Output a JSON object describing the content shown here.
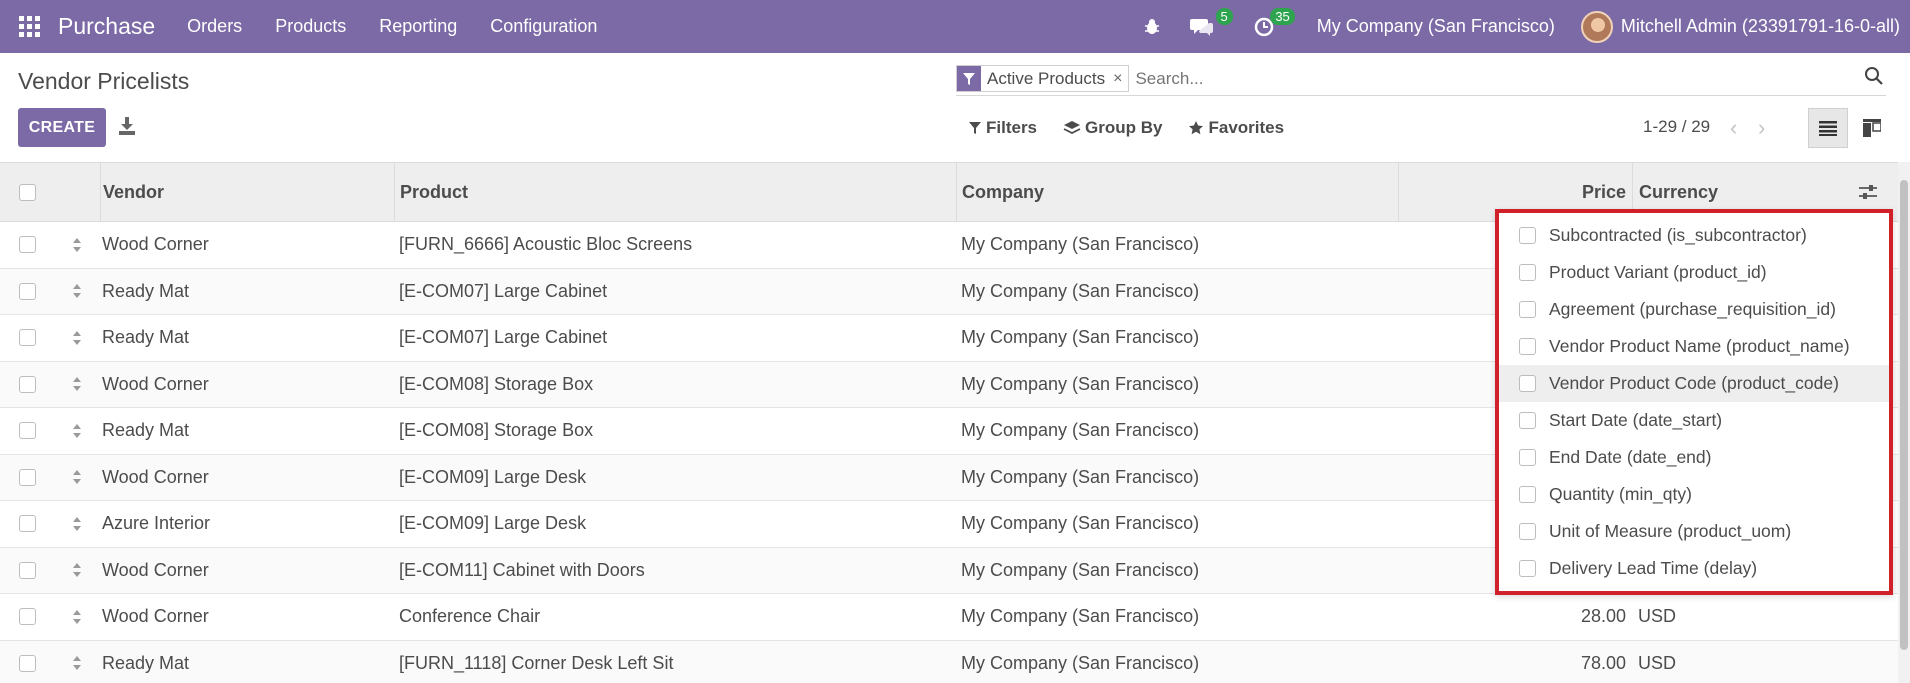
{
  "navbar": {
    "brand": "Purchase",
    "menu": [
      "Orders",
      "Products",
      "Reporting",
      "Configuration"
    ],
    "messages_badge": "5",
    "activities_badge": "35",
    "company": "My Company (San Francisco)",
    "user": "Mitchell Admin (23391791-16-0-all)",
    "color": "#7c6aa6"
  },
  "control": {
    "title": "Vendor Pricelists",
    "create_label": "CREATE",
    "facet_label": "Active Products",
    "facet_close": "×",
    "search_placeholder": "Search...",
    "filters_label": "Filters",
    "groupby_label": "Group By",
    "favorites_label": "Favorites",
    "pager": "1-29 / 29"
  },
  "table": {
    "headers": {
      "vendor": "Vendor",
      "product": "Product",
      "company": "Company",
      "price": "Price",
      "currency": "Currency"
    },
    "rows": [
      {
        "vendor": "Wood Corner",
        "product": "[FURN_6666] Acoustic Bloc Screens",
        "company": "My Company (San Francisco)",
        "price": "",
        "currency": ""
      },
      {
        "vendor": "Ready Mat",
        "product": "[E-COM07] Large Cabinet",
        "company": "My Company (San Francisco)",
        "price": "",
        "currency": ""
      },
      {
        "vendor": "Ready Mat",
        "product": "[E-COM07] Large Cabinet",
        "company": "My Company (San Francisco)",
        "price": "",
        "currency": ""
      },
      {
        "vendor": "Wood Corner",
        "product": "[E-COM08] Storage Box",
        "company": "My Company (San Francisco)",
        "price": "",
        "currency": ""
      },
      {
        "vendor": "Ready Mat",
        "product": "[E-COM08] Storage Box",
        "company": "My Company (San Francisco)",
        "price": "",
        "currency": ""
      },
      {
        "vendor": "Wood Corner",
        "product": "[E-COM09] Large Desk",
        "company": "My Company (San Francisco)",
        "price": "",
        "currency": ""
      },
      {
        "vendor": "Azure Interior",
        "product": "[E-COM09] Large Desk",
        "company": "My Company (San Francisco)",
        "price": "",
        "currency": ""
      },
      {
        "vendor": "Wood Corner",
        "product": "[E-COM11] Cabinet with Doors",
        "company": "My Company (San Francisco)",
        "price": "",
        "currency": ""
      },
      {
        "vendor": "Wood Corner",
        "product": "Conference Chair",
        "company": "My Company (San Francisco)",
        "price": "28.00",
        "currency": "USD"
      },
      {
        "vendor": "Ready Mat",
        "product": "[FURN_1118] Corner Desk Left Sit",
        "company": "My Company (San Francisco)",
        "price": "78.00",
        "currency": "USD"
      }
    ]
  },
  "optional_columns": {
    "items": [
      "Subcontracted (is_subcontractor)",
      "Product Variant (product_id)",
      "Agreement (purchase_requisition_id)",
      "Vendor Product Name (product_name)",
      "Vendor Product Code (product_code)",
      "Start Date (date_start)",
      "End Date (date_end)",
      "Quantity (min_qty)",
      "Unit of Measure (product_uom)",
      "Delivery Lead Time (delay)"
    ],
    "hovered_index": 4,
    "highlight_color": "#d0202a"
  }
}
